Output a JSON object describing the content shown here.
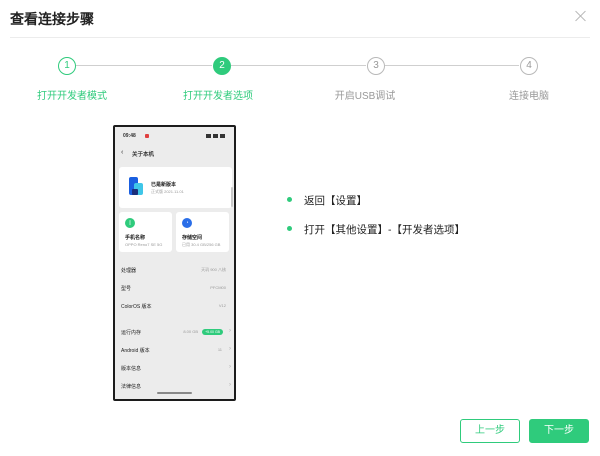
{
  "dialog": {
    "title": "查看连接步骤"
  },
  "steps": [
    {
      "number": "1",
      "label": "打开开发者模式",
      "state": "done"
    },
    {
      "number": "2",
      "label": "打开开发者选项",
      "state": "active"
    },
    {
      "number": "3",
      "label": "开启USB调试",
      "state": "pending"
    },
    {
      "number": "4",
      "label": "连接电脑",
      "state": "pending"
    }
  ],
  "colors": {
    "accent": "#2fcb7c",
    "inactive": "#999999"
  },
  "phone": {
    "time": "09:48",
    "back_icon": "‹",
    "page_title": "关于本机",
    "version_card": {
      "title": "已是新版本",
      "subtitle": "正式版 2021.11.01"
    },
    "tiles": [
      {
        "icon": "phone-icon",
        "glyph": "▯",
        "title": "手机名称",
        "subtitle": "OPPO Reno7 SE 5G",
        "color": "#2fcb7c"
      },
      {
        "icon": "storage-icon",
        "glyph": "◔",
        "title": "存储空间",
        "subtitle": "已用 30.4 GB/256 GB",
        "color": "#2a6ee8"
      }
    ],
    "info_rows": [
      {
        "key": "处理器",
        "value": "天玑 900 八核"
      },
      {
        "key": "型号",
        "value": "PFCM00"
      },
      {
        "key": "ColorOS 版本",
        "value": "V12"
      }
    ],
    "nav_rows": [
      {
        "key": "运行内存",
        "value": "8.00 GB",
        "pill": "+5.00 GB",
        "chevron": "›"
      },
      {
        "key": "Android 版本",
        "value": "11",
        "chevron": "›"
      },
      {
        "key": "版本信息",
        "value": "",
        "chevron": "›"
      },
      {
        "key": "法律信息",
        "value": "",
        "chevron": "›"
      }
    ]
  },
  "instructions": [
    {
      "text": "返回【设置】"
    },
    {
      "text": "打开【其他设置】-【开发者选项】"
    }
  ],
  "buttons": {
    "prev": "上一步",
    "next": "下一步"
  }
}
